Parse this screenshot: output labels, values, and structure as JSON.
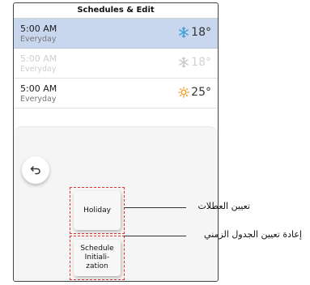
{
  "header": {
    "title": "Schedules & Edit"
  },
  "schedules": [
    {
      "time": "5:00 AM",
      "repeat": "Everyday",
      "temp": "18°",
      "mode_icon": "snowflake-icon",
      "state": "selected"
    },
    {
      "time": "5:00 AM",
      "repeat": "Everyday",
      "temp": "18°",
      "mode_icon": "snowflake-icon",
      "state": "disabled"
    },
    {
      "time": "5:00 AM",
      "repeat": "Everyday",
      "temp": "25°",
      "mode_icon": "sun-icon",
      "state": "normal"
    }
  ],
  "buttons": {
    "holiday_label": "Holiday",
    "schedule_init_label": "Schedule\nInitiali-\nzation"
  },
  "annotations": {
    "holiday": "تعيين العطلات",
    "schedule_init": "إعادة تعيين الجدول الزمني"
  },
  "colors": {
    "selected_bg": "#c8d6ee",
    "cool": "#3aa0d8",
    "heat": "#f39a21",
    "highlight": "#e0322f"
  }
}
